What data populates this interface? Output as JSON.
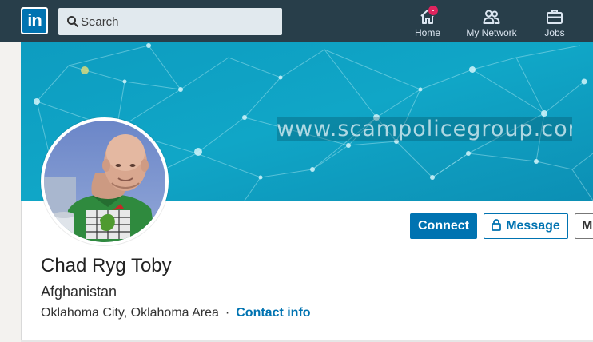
{
  "app": {
    "logo_text": "in",
    "brand_color": "#0073b1",
    "topbar_color": "#283e4a"
  },
  "search": {
    "placeholder": "Search",
    "icon": "search-icon"
  },
  "nav": {
    "items": [
      {
        "label": "Home",
        "icon": "home-icon",
        "has_badge": true
      },
      {
        "label": "My Network",
        "icon": "people-icon"
      },
      {
        "label": "Jobs",
        "icon": "briefcase-icon"
      }
    ]
  },
  "banner": {
    "watermark_text": "www.scampolicegroup.com"
  },
  "profile": {
    "name": "Chad Ryg Toby",
    "headline": "Afghanistan",
    "location": "Oklahoma City, Oklahoma Area",
    "separator": "·",
    "contact_label": "Contact info"
  },
  "actions": {
    "connect_label": "Connect",
    "message_label": "Message",
    "more_label": "M"
  }
}
